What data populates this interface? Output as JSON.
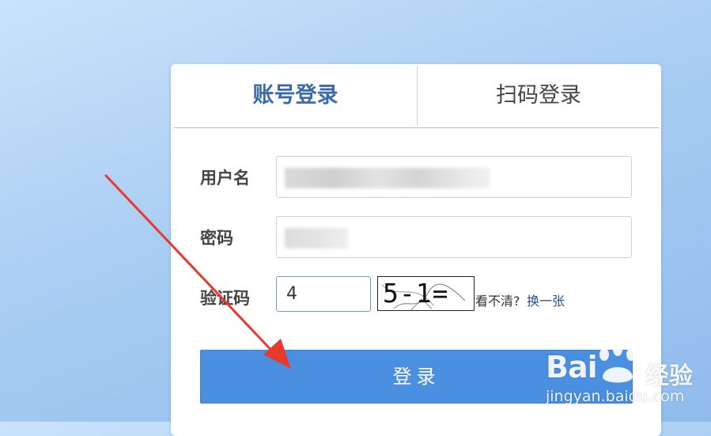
{
  "tabs": {
    "account_login": "账号登录",
    "qr_login": "扫码登录"
  },
  "form": {
    "username_label": "用户名",
    "password_label": "密码",
    "captcha_label": "验证码",
    "captcha_value": "4",
    "captcha_image_text": "5-1=",
    "captcha_hint": "看不清?",
    "captcha_refresh": "换一张",
    "submit_label": "登录"
  },
  "watermark": {
    "logo": "Bai",
    "logo_suffix": "经验",
    "url": "jingyan.baidu.com"
  },
  "colors": {
    "active_tab": "#3b6aa8",
    "button": "#4a8fe0",
    "arrow": "#e8392e"
  }
}
